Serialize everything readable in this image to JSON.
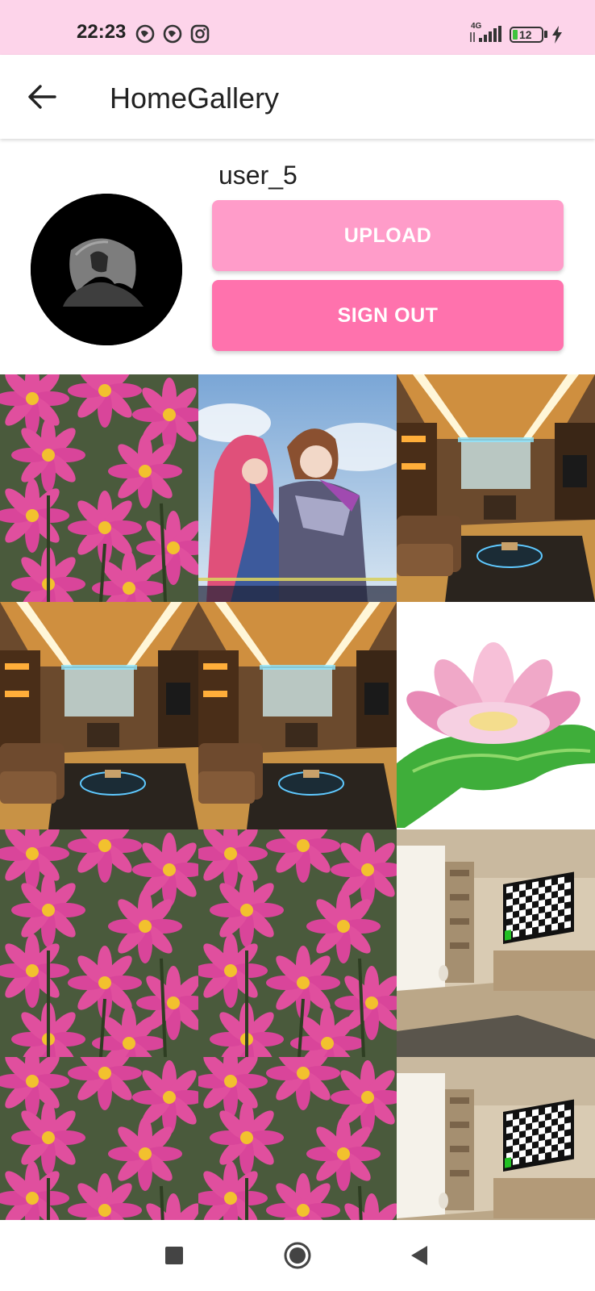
{
  "status_bar": {
    "time": "22:23",
    "network_label": "4G",
    "battery_level": "12",
    "icons": [
      "vpn-key-icon",
      "vpn-key-icon",
      "instagram-icon",
      "signal-icon",
      "battery-icon",
      "charging-icon"
    ]
  },
  "app_bar": {
    "title": "HomeGallery",
    "back_icon": "arrow-left-icon"
  },
  "profile": {
    "username": "user_5",
    "avatar": "hooded-figure-avatar"
  },
  "buttons": {
    "upload_label": "UPLOAD",
    "sign_out_label": "SIGN OUT"
  },
  "gallery": {
    "tiles": [
      "pink-flowers",
      "game-artwork",
      "office-interior",
      "office-interior",
      "office-interior",
      "pink-lotus",
      "pink-flowers",
      "pink-flowers",
      "room-with-tv",
      "pink-flowers",
      "pink-flowers",
      "room-with-tv"
    ]
  },
  "nav_bar": {
    "icons": [
      "recents-square-icon",
      "home-circle-icon",
      "back-triangle-icon"
    ]
  },
  "colors": {
    "status_bar_bg": "#fdd4ea",
    "upload_button": "#ff9cc9",
    "sign_out_button": "#ff72ad"
  }
}
